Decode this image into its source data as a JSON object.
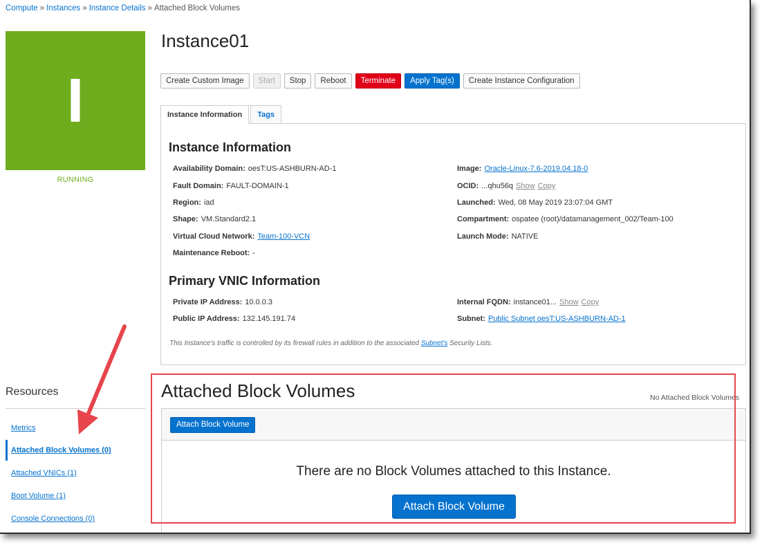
{
  "breadcrumb": {
    "items": [
      "Compute",
      "Instances",
      "Instance Details"
    ],
    "current": "Attached Block Volumes",
    "separator": "»"
  },
  "instance": {
    "avatar_letter": "I",
    "avatar_color": "#6fac1d",
    "state": "RUNNING",
    "name": "Instance01"
  },
  "actions": {
    "create_custom_image": "Create Custom Image",
    "start": "Start",
    "stop": "Stop",
    "reboot": "Reboot",
    "terminate": "Terminate",
    "apply_tags": "Apply Tag(s)",
    "create_instance_configuration": "Create Instance Configuration"
  },
  "tabs": [
    {
      "label": "Instance Information",
      "active": true
    },
    {
      "label": "Tags",
      "active": false
    }
  ],
  "instance_info": {
    "heading": "Instance Information",
    "availability_domain": {
      "label": "Availability Domain:",
      "value": "oesT:US-ASHBURN-AD-1"
    },
    "fault_domain": {
      "label": "Fault Domain:",
      "value": "FAULT-DOMAIN-1"
    },
    "region": {
      "label": "Region:",
      "value": "iad"
    },
    "shape": {
      "label": "Shape:",
      "value": "VM.Standard2.1"
    },
    "vcn": {
      "label": "Virtual Cloud Network:",
      "value": "Team-100-VCN"
    },
    "maintenance_reboot": {
      "label": "Maintenance Reboot:",
      "value": "-"
    },
    "image": {
      "label": "Image:",
      "value": "Oracle-Linux-7.6-2019.04.18-0"
    },
    "ocid": {
      "label": "OCID:",
      "value": "...qhu56q",
      "show": "Show",
      "copy": "Copy"
    },
    "launched": {
      "label": "Launched:",
      "value": "Wed, 08 May 2019 23:07:04 GMT"
    },
    "compartment": {
      "label": "Compartment:",
      "value": "ospatee (root)/datamanagement_002/Team-100"
    },
    "launch_mode": {
      "label": "Launch Mode:",
      "value": "NATIVE"
    }
  },
  "vnic_info": {
    "heading": "Primary VNIC Information",
    "private_ip": {
      "label": "Private IP Address:",
      "value": "10.0.0.3"
    },
    "public_ip": {
      "label": "Public IP Address:",
      "value": "132.145.191.74"
    },
    "internal_fqdn": {
      "label": "Internal FQDN:",
      "value": "instance01...",
      "show": "Show",
      "copy": "Copy"
    },
    "subnet": {
      "label": "Subnet:",
      "value": "Public Subnet oesT:US-ASHBURN-AD-1"
    },
    "note_prefix": "This Instance's traffic is controlled by its firewall rules in addition to the associated",
    "note_link": "Subnet's",
    "note_suffix": "Security Lists."
  },
  "attached_block_volumes": {
    "title": "Attached Block Volumes",
    "count_text": "No Attached Block Volumes",
    "toolbar_button": "Attach Block Volume",
    "empty_message": "There are no Block Volumes attached to this Instance.",
    "empty_button": "Attach Block Volume"
  },
  "resources": {
    "title": "Resources",
    "items": [
      {
        "label": "Metrics",
        "active": false
      },
      {
        "label": "Attached Block Volumes (0)",
        "active": true
      },
      {
        "label": "Attached VNICs (1)",
        "active": false
      },
      {
        "label": "Boot Volume (1)",
        "active": false
      },
      {
        "label": "Console Connections (0)",
        "active": false
      }
    ]
  },
  "annotation": {
    "arrow_color": "#e6454b",
    "box_color": "#e6454b"
  }
}
